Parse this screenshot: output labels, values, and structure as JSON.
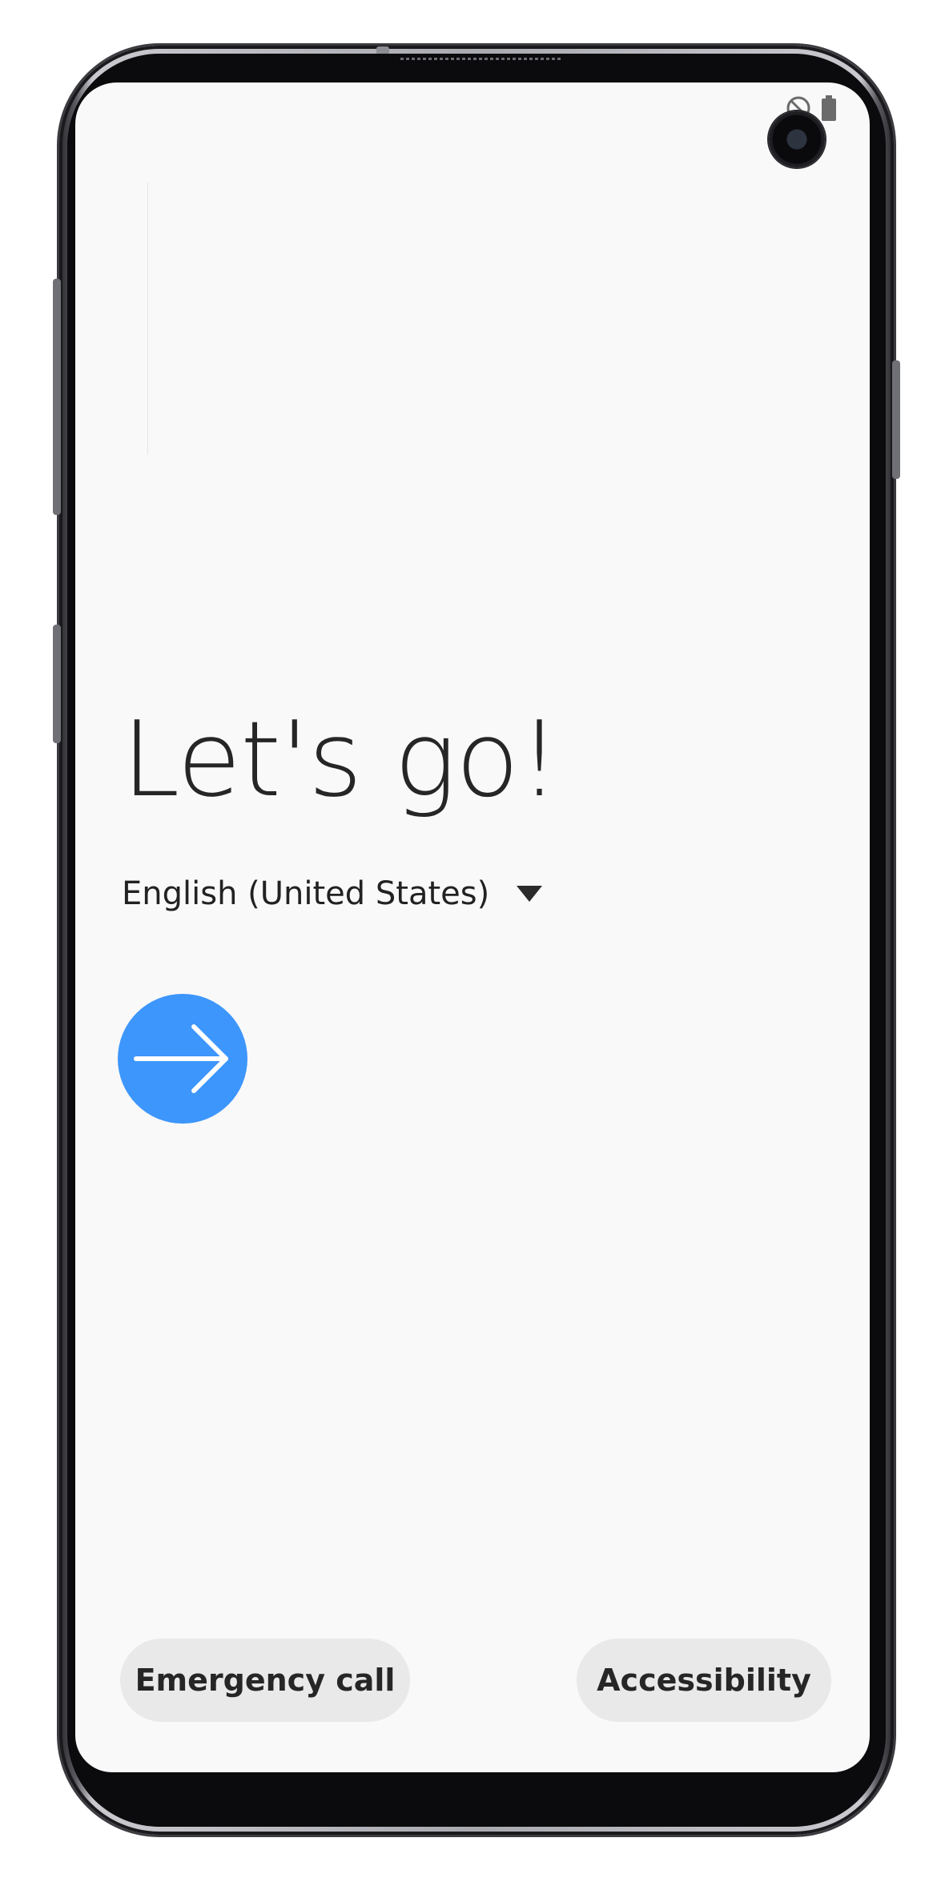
{
  "screen": {
    "greeting": "Let's go!",
    "language": {
      "selected": "English (United States)"
    },
    "next_button_icon": "arrow-right-icon",
    "bottom_buttons": {
      "emergency_label": "Emergency call",
      "accessibility_label": "Accessibility"
    }
  },
  "status_bar": {
    "icons": [
      "no-sim-icon",
      "battery-icon"
    ]
  },
  "colors": {
    "accent": "#3d96fb",
    "screen_background": "#f9f9f9",
    "pill_background": "#e9e9e9",
    "text": "#262626"
  }
}
